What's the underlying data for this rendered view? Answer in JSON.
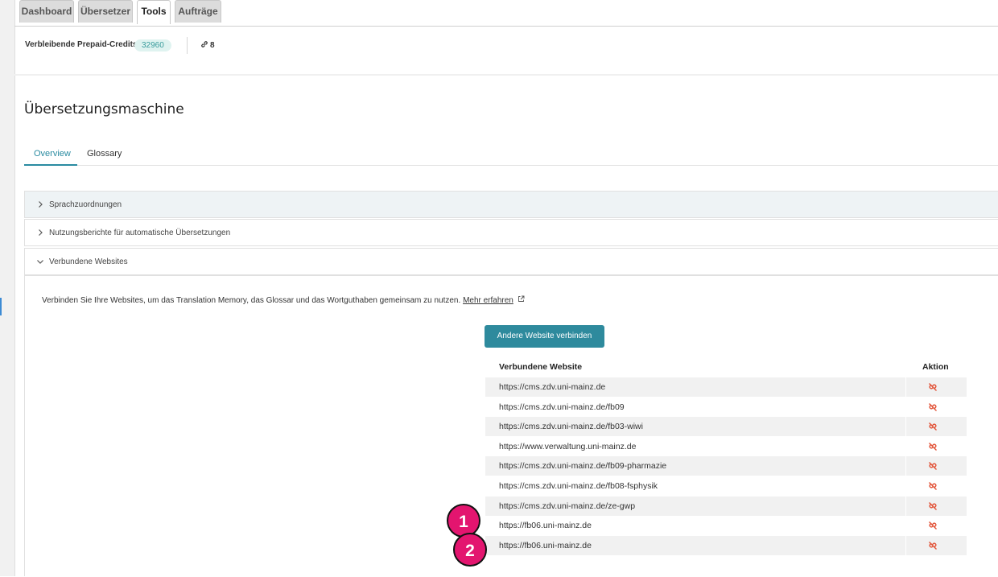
{
  "tabs": [
    {
      "label": "Dashboard",
      "active": false
    },
    {
      "label": "Übersetzer",
      "active": false
    },
    {
      "label": "Tools",
      "active": true
    },
    {
      "label": "Aufträge",
      "active": false
    }
  ],
  "credits": {
    "label": "Verbleibende Prepaid-Credits",
    "value": "32960",
    "linked_count": "8"
  },
  "page_title": "Übersetzungsmaschine",
  "subtabs": [
    {
      "label": "Overview",
      "active": true
    },
    {
      "label": "Glossary",
      "active": false
    }
  ],
  "accordion": [
    {
      "label": "Sprachzuordnungen",
      "expanded": false
    },
    {
      "label": "Nutzungsberichte für automatische Übersetzungen",
      "expanded": false
    },
    {
      "label": "Verbundene Websites",
      "expanded": true
    }
  ],
  "connected": {
    "description": "Verbinden Sie Ihre Websites, um das Translation Memory, das Glossar und das Wortguthaben gemeinsam zu nutzen.",
    "learn_more": "Mehr erfahren",
    "connect_button": "Andere Website verbinden",
    "col_website": "Verbundene Website",
    "col_action": "Aktion",
    "rows": [
      "https://cms.zdv.uni-mainz.de",
      "https://cms.zdv.uni-mainz.de/fb09",
      "https://cms.zdv.uni-mainz.de/fb03-wiwi",
      "https://www.verwaltung.uni-mainz.de",
      "https://cms.zdv.uni-mainz.de/fb09-pharmazie",
      "https://cms.zdv.uni-mainz.de/fb08-fsphysik",
      "https://cms.zdv.uni-mainz.de/ze-gwp",
      "https://fb06.uni-mainz.de",
      "https://fb06.uni-mainz.de"
    ]
  },
  "markers": [
    "1",
    "2"
  ],
  "colors": {
    "accent": "#2e8a9d",
    "unlink": "#e2553a",
    "marker": "#e3156f",
    "badge_bg": "#dff3f0"
  }
}
